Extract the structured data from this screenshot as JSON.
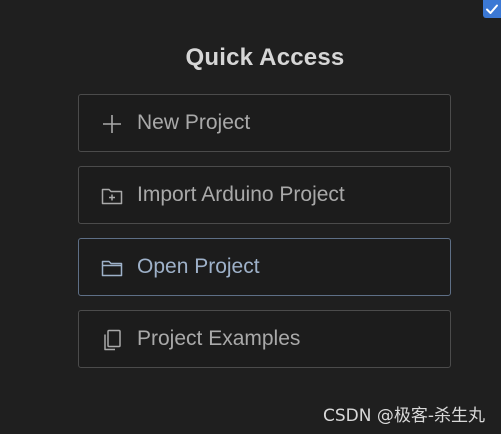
{
  "quick_access": {
    "title": "Quick Access",
    "actions": [
      {
        "label": "New Project",
        "icon": "plus-icon"
      },
      {
        "label": "Import Arduino Project",
        "icon": "folder-import-icon"
      },
      {
        "label": "Open Project",
        "icon": "folder-icon",
        "state": "hovered"
      },
      {
        "label": "Project Examples",
        "icon": "copy-icon"
      }
    ]
  },
  "watermark": "CSDN @极客-杀生丸",
  "colors": {
    "background": "#1f1f1f",
    "card_background": "#1c1c1c",
    "card_border": "#4b4b4b",
    "active_border": "#5e6f86",
    "text": "#a9a9a9",
    "title": "#d6d6d6",
    "accent": "#3b78d4"
  }
}
